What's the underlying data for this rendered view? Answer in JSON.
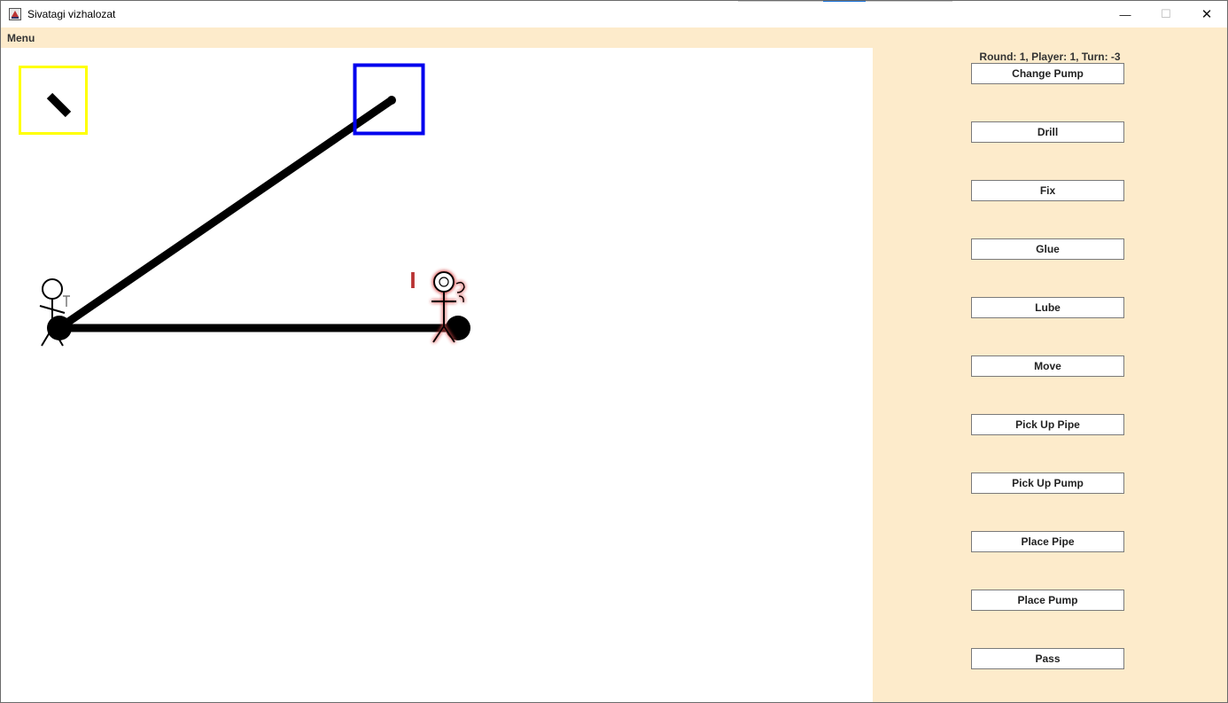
{
  "window": {
    "title": "Sivatagi vizhalozat",
    "app_icon": "java-cup-icon"
  },
  "titlebar_controls": {
    "minimize": "—",
    "maximize": "☐",
    "close": "✕"
  },
  "menu": {
    "label": "Menu"
  },
  "status": {
    "round_label": "Round: ",
    "round": "1",
    "player_label": ", Player: ",
    "player": "1",
    "turn_label": ", Turn: ",
    "turn": "-3"
  },
  "actions": [
    "Change Pump",
    "Drill",
    "Fix",
    "Glue",
    "Lube",
    "Move",
    "Pick Up Pipe",
    "Pick Up Pump",
    "Place Pipe",
    "Place Pump",
    "Pass"
  ],
  "game": {
    "active_player_tag": "I",
    "colors": {
      "pipe": "#000000",
      "cistern_frame": "#ffff00",
      "source_frame": "#0000ff",
      "active_player": "#e04848",
      "panel_bg": "#fdebcb"
    }
  }
}
